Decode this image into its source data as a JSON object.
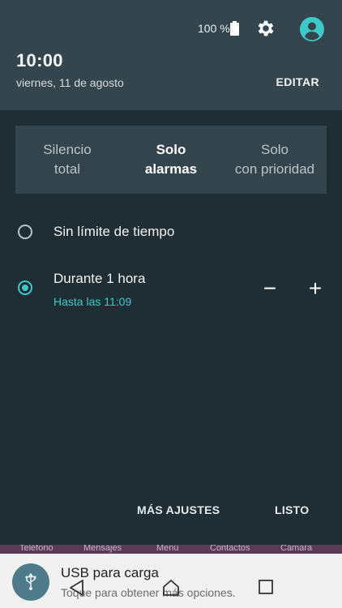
{
  "status": {
    "battery": "100 %"
  },
  "header": {
    "time": "10:00",
    "date": "viernes,  11 de agosto",
    "edit": "EDITAR"
  },
  "tabs": [
    {
      "line1": "Silencio",
      "line2": "total",
      "active": false
    },
    {
      "line1": "Solo",
      "line2": "alarmas",
      "active": true
    },
    {
      "line1": "Solo",
      "line2": "con prioridad",
      "active": false
    }
  ],
  "options": {
    "unlimited": "Sin límite de tiempo",
    "timed": "Durante 1 hora",
    "timed_sub": "Hasta las 11:09",
    "minus": "−",
    "plus": "+"
  },
  "footer": {
    "more": "MÁS AJUSTES",
    "done": "LISTO"
  },
  "dock": [
    "Teléfono",
    "Mensajes",
    "Menú",
    "Contactos",
    "Cámara"
  ],
  "notification": {
    "title": "USB para carga",
    "subtitle": "Toque para obtener más opciones."
  },
  "colors": {
    "accent": "#3ec9c9",
    "header_bg": "#35454d",
    "panel_bg": "#1f2d35"
  },
  "icons": [
    "battery-icon",
    "gear-icon",
    "avatar-icon",
    "usb-icon",
    "back-icon",
    "home-icon",
    "recents-icon"
  ]
}
